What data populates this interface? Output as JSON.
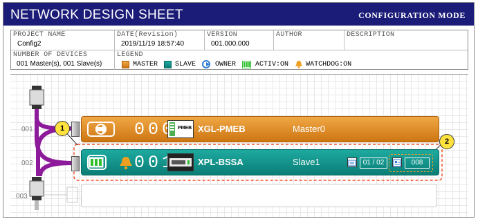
{
  "header": {
    "title": "NETWORK DESIGN SHEET",
    "mode": "CONFIGURATION MODE"
  },
  "info": {
    "project_name_label": "PROJECT NAME",
    "project_name": "Config2",
    "date_label": "DATE(Revision)",
    "date": "2019/11/19 18:57:40",
    "version_label": "VERSION",
    "version": "001.000.000",
    "author_label": "AUTHOR",
    "author": "",
    "description_label": "DESCRIPTION",
    "description": "",
    "devices_label": "NUMBER OF DEVICES",
    "devices": "001 Master(s), 001 Slave(s)",
    "legend_label": "LEGEND",
    "legend": {
      "master": "MASTER",
      "slave": "SLAVE",
      "owner": "OWNER",
      "activ": "ACTIV:ON",
      "watchdog": "WATCHDOG:ON"
    }
  },
  "colors": {
    "master": "#d98a1c",
    "slave": "#0f918a",
    "title_bar": "#1b1b78",
    "callout": "#ffe23d",
    "highlight": "#f0522a",
    "owner_icon": "#2d7bd6",
    "active_icon": "#2fbf2f",
    "watchdog_icon": "#f0a020"
  },
  "network": {
    "row_numbers": [
      "001",
      "002",
      "003"
    ],
    "devices": [
      {
        "type": "master",
        "icon": "owner-icon",
        "station": "000",
        "image_label": "PMEB",
        "name": "XGL-PMEB",
        "role": "Master0"
      },
      {
        "type": "slave",
        "icons": [
          "activ-on-icon",
          "watchdog-icon"
        ],
        "station": "001",
        "name": "XPL-BSSA",
        "role": "Slave1",
        "io_value": "01 / 02",
        "param_value": "008"
      }
    ]
  },
  "callouts": [
    "1",
    "2"
  ]
}
